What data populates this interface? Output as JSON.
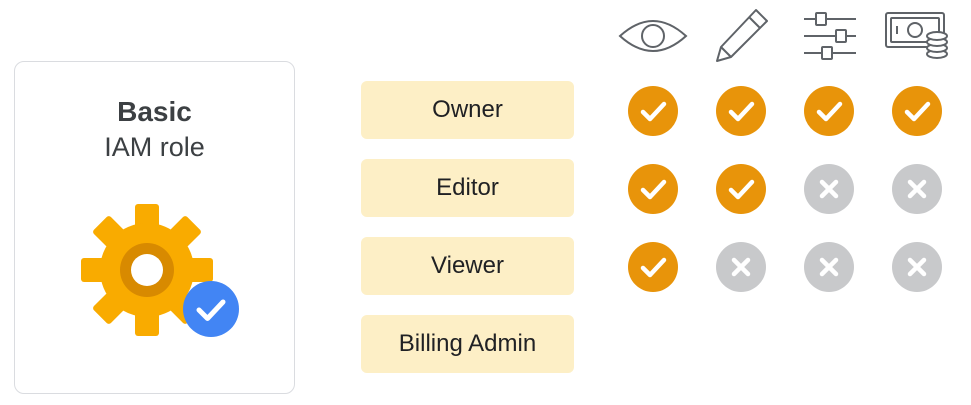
{
  "card": {
    "title": "Basic",
    "subtitle": "IAM role",
    "gear_icon": "gear-icon",
    "badge_icon": "check-circle-icon",
    "gear_color": "#f9ab00",
    "gear_hole_color": "#d88a00",
    "badge_color": "#4285f4"
  },
  "roles": [
    {
      "label": "Owner"
    },
    {
      "label": "Editor"
    },
    {
      "label": "Viewer"
    },
    {
      "label": "Billing Admin"
    }
  ],
  "permission_icons": [
    "eye-icon",
    "pencil-icon",
    "sliders-icon",
    "money-icon"
  ],
  "matrix": [
    [
      "check",
      "check",
      "check",
      "check"
    ],
    [
      "check",
      "check",
      "cross",
      "cross"
    ],
    [
      "check",
      "cross",
      "cross",
      "cross"
    ]
  ],
  "colors": {
    "role_bg": "#fdefc6",
    "check": "#e8940a",
    "cross": "#c8c9cb"
  }
}
